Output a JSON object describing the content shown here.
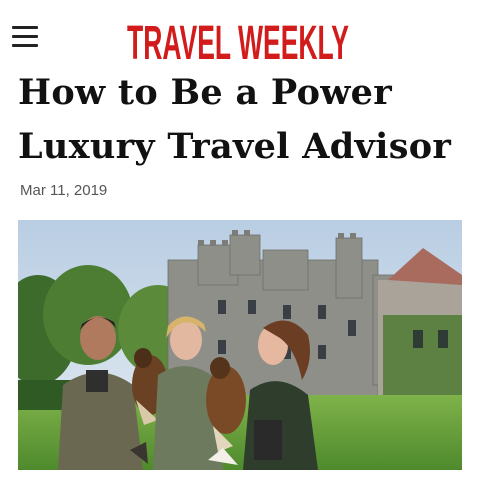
{
  "header": {
    "menu_icon": "hamburger-menu-icon",
    "brand_name": "TRAVEL WEEKLY",
    "brand_color": "#d21c1c"
  },
  "article": {
    "title_line1": "How to Be a Power",
    "title_line2": "Luxury Travel Advisor",
    "date": "Mar 11, 2019"
  },
  "photo": {
    "image_content": "falconers-at-castle"
  }
}
